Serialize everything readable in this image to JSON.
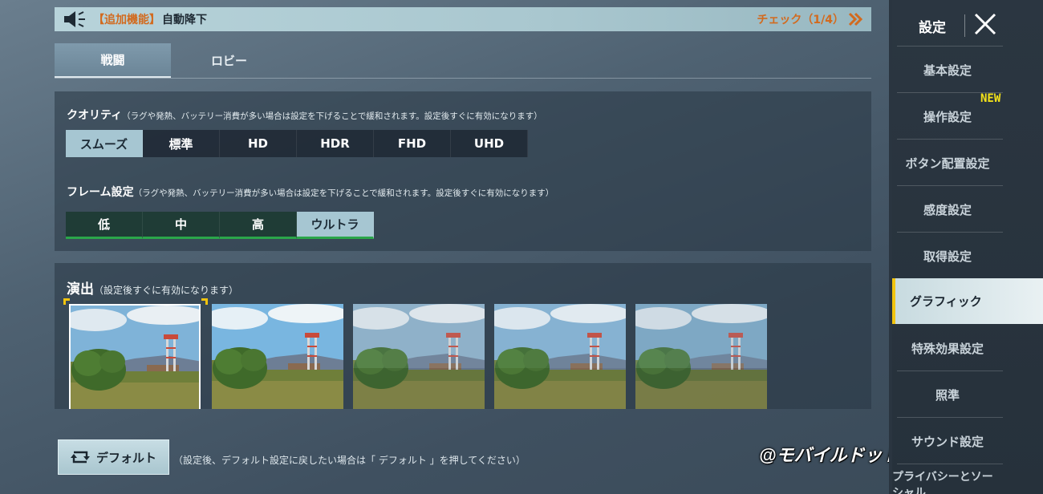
{
  "banner": {
    "tag": "【追加機能】",
    "title": "自動降下",
    "check": "チェック（1/4）",
    "icons": {
      "left": "speaker-icon",
      "right": "double-chevron-right-icon"
    }
  },
  "tabs": [
    {
      "label": "戦闘",
      "selected": true
    },
    {
      "label": "ロビー",
      "selected": false
    }
  ],
  "quality": {
    "label": "クオリティ",
    "note": "（ラグや発熱、バッテリー消費が多い場合は設定を下げることで緩和されます。設定後すぐに有効になります）",
    "options": [
      "スムーズ",
      "標準",
      "HD",
      "HDR",
      "FHD",
      "UHD"
    ],
    "selected": "スムーズ"
  },
  "frame": {
    "label": "フレーム設定",
    "note": "（ラグや発熱、バッテリー消費が多い場合は設定を下げることで緩和されます。設定後すぐに有効になります）",
    "options": [
      "低",
      "中",
      "高",
      "ウルトラ"
    ],
    "selected": "ウルトラ"
  },
  "effects": {
    "label": "演出",
    "note": "（設定後すぐに有効になります）",
    "thumbnails": 5,
    "selected_index": 0
  },
  "default_button": {
    "label": "デフォルト",
    "icon": "reset-arrows-icon",
    "note": "（設定後、デフォルト設定に戻したい場合は「 デフォルト 」を押してください）"
  },
  "watermark": "@モバイルドットコム",
  "sidebar": {
    "title": "設定",
    "close_icon": "close-icon",
    "items": [
      {
        "label": "基本設定"
      },
      {
        "label": "操作設定",
        "badge": "NEW"
      },
      {
        "label": "ボタン配置設定"
      },
      {
        "label": "感度設定"
      },
      {
        "label": "取得設定"
      },
      {
        "label": "グラフィック",
        "selected": true
      },
      {
        "label": "特殊効果設定"
      },
      {
        "label": "照準"
      },
      {
        "label": "サウンド設定"
      },
      {
        "label": "プライバシーとソーシャル"
      }
    ]
  },
  "colors": {
    "accent_orange": "#d26a1e",
    "selected_bg": "#a6c6d2",
    "frame_green": "#2aa64a",
    "badge_yellow": "#f4e21a",
    "selection_corner": "#f1c40f"
  }
}
